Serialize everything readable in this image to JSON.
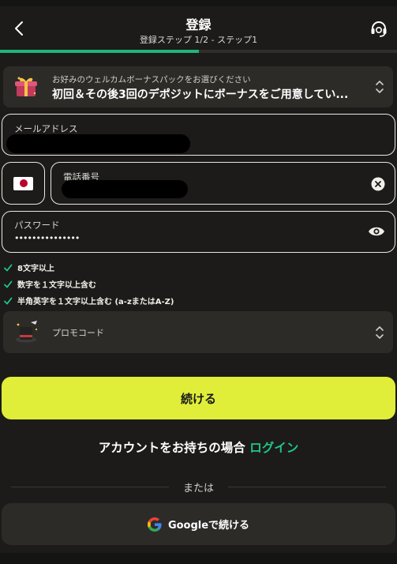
{
  "header": {
    "title": "登録",
    "subtitle": "登録ステップ 1/2 - ステップ1",
    "progress_fraction": 0.5
  },
  "bonus": {
    "hint": "お好みのウェルカムボーナスパックをお選びください",
    "selected": "初回＆その後3回のデポジットにボーナスをご用意してい..."
  },
  "form": {
    "email_label": "メールアドレス",
    "phone_label": "電話番号",
    "password_label": "パスワード",
    "password_value": "•••••••••••••••"
  },
  "password_rules": [
    "8文字以上",
    "数字を１文字以上含む",
    "半角英字を１文字以上含む (a-zまたはA-Z)"
  ],
  "promo": {
    "label": "プロモコード"
  },
  "continue_label": "続ける",
  "login": {
    "prompt": "アカウントをお持ちの場合",
    "link": "ログイン"
  },
  "divider_label": "または",
  "google_label": "Googleで続ける",
  "colors": {
    "accent_green": "#1fc688",
    "primary_button": "#e0ee3a",
    "background": "#1c1b19",
    "panel": "#2c2b28"
  },
  "icons": [
    "chevron-left-icon",
    "support-icon",
    "gift-box-icon",
    "select-arrows-icon",
    "japan-flag-icon",
    "clear-icon",
    "eye-icon",
    "check-icon",
    "magic-hat-icon",
    "google-logo-icon"
  ]
}
